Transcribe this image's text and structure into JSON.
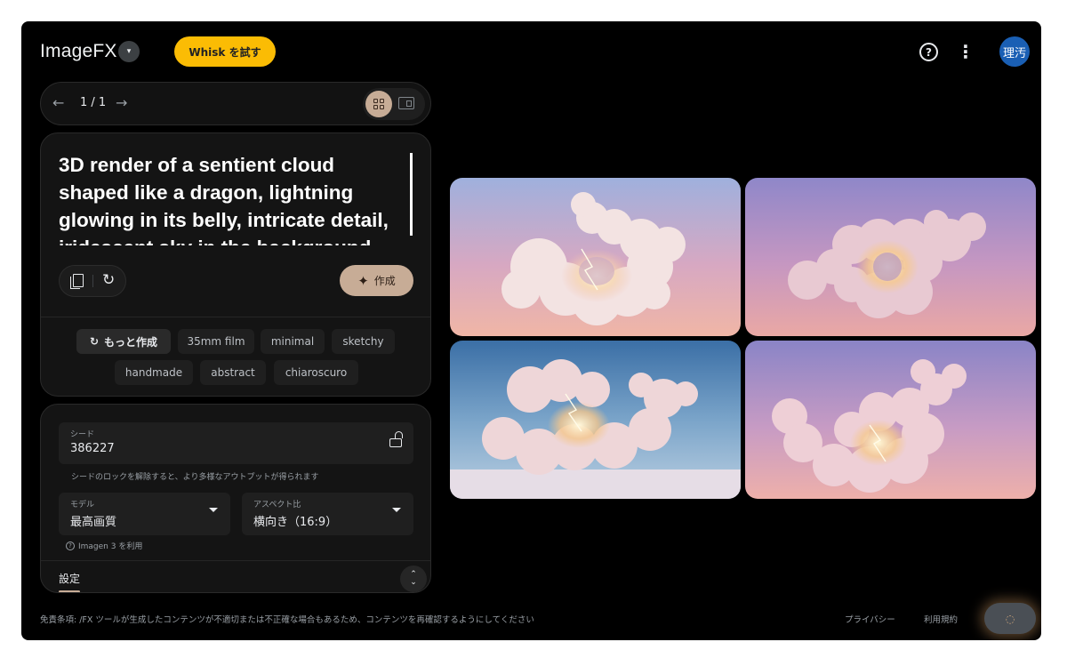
{
  "header": {
    "logo": "ImageFX",
    "logo_dropdown_glyph": "▾",
    "whisk_button": "Whisk を試す",
    "help_glyph": "?",
    "more_glyph": "⋮",
    "avatar_text": "理汚"
  },
  "pager": {
    "prev_glyph": "←",
    "next_glyph": "→",
    "count": "1 / 1"
  },
  "prompt": {
    "text": "3D render of a sentient cloud shaped like a dragon, lightning glowing in its belly, intricate detail, iridescent sky in the background",
    "create_button": "作成",
    "create_icon": "✦",
    "reset_glyph": "↻"
  },
  "chips": {
    "more_button": "もっと作成",
    "more_icon": "↻",
    "items": [
      "35mm film",
      "minimal",
      "sketchy",
      "handmade",
      "abstract",
      "chiaroscuro"
    ]
  },
  "settings": {
    "seed_label": "シード",
    "seed_value": "386227",
    "seed_hint": "シードのロックを解除すると、より多様なアウトプットが得られます",
    "model_label": "モデル",
    "model_value": "最高画質",
    "aspect_label": "アスペクト比",
    "aspect_value": "横向き（16:9）",
    "imagen_note": "Imagen 3 を利用",
    "imagen_glyph": "?",
    "tab_label": "設定",
    "collapse_up": "⌃",
    "collapse_down": "⌄"
  },
  "footer": {
    "disclaimer": "免責条項: /FX ツールが生成したコンテンツが不適切または不正確な場合もあるため、コンテンツを再確認するようにしてください",
    "privacy": "プライバシー",
    "terms": "利用規約",
    "fab_glyph": "◌"
  },
  "colors": {
    "accent_yellow": "#fbbc04",
    "accent_tan": "#c7ac96",
    "background": "#000000",
    "card": "#141414"
  }
}
